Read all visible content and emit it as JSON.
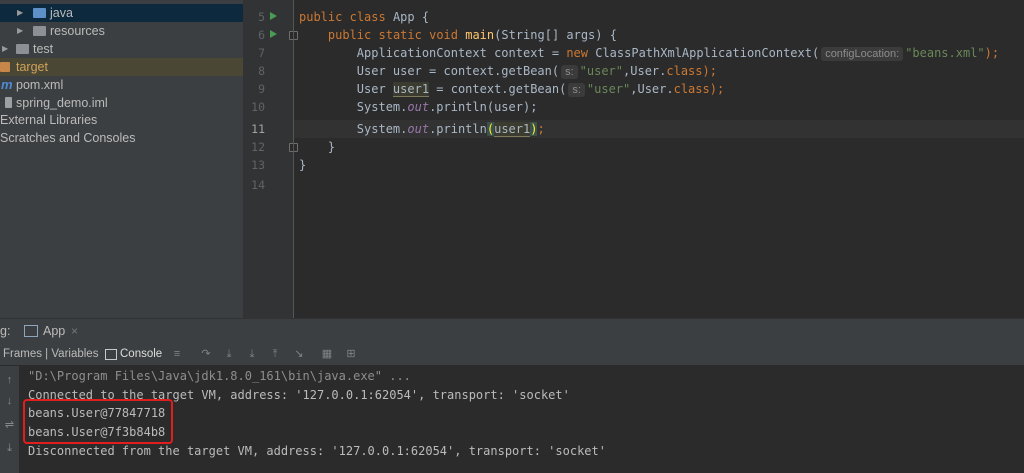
{
  "project_tree": {
    "items": [
      {
        "label": "java",
        "icon": "folder-source-icon"
      },
      {
        "label": "resources",
        "icon": "folder-resources-icon"
      },
      {
        "label": "test",
        "icon": "folder-icon"
      },
      {
        "label": "target",
        "icon": "folder-excluded-icon"
      },
      {
        "label": "pom.xml",
        "icon": "maven-icon"
      },
      {
        "label": "spring_demo.iml",
        "icon": "file-icon"
      },
      {
        "label": "External Libraries",
        "icon": "libraries-icon"
      },
      {
        "label": "Scratches and Consoles",
        "icon": "scratches-icon"
      }
    ]
  },
  "editor": {
    "line_numbers": [
      "5",
      "6",
      "7",
      "8",
      "9",
      "10",
      "11",
      "12",
      "13",
      "14"
    ],
    "current_line": "11",
    "code": {
      "l5": {
        "kw1": "public",
        "kw2": "class",
        "name": "App {"
      },
      "l6": {
        "kw1": "public",
        "kw2": "static",
        "kw3": "void",
        "fn": "main",
        "rest": "(String[] args) {"
      },
      "l7": {
        "a": "ApplicationContext context = ",
        "kw": "new",
        "b": " ClassPathXmlApplicationContext(",
        "hint": "configLocation:",
        "str": "\"beans.xml\"",
        "end": ");"
      },
      "l8": {
        "a": "User user = context.getBean(",
        "hint": "s:",
        "str": "\"user\"",
        "b": ",User.",
        "kw": "class",
        "end": ");"
      },
      "l9": {
        "a": "User ",
        "var": "user1",
        "b": " = context.getBean(",
        "hint": "s:",
        "str": "\"user\"",
        "c": ",User.",
        "kw": "class",
        "end": ");"
      },
      "l10": {
        "a": "System.",
        "out": "out",
        "b": ".println(user);"
      },
      "l11": {
        "a": "System.",
        "out": "out",
        "b": ".println",
        "lp": "(",
        "var": "user1",
        "rp": ")",
        "end": ";"
      },
      "l12": {
        "text": "}"
      },
      "l13": {
        "text": "}"
      }
    }
  },
  "run_window": {
    "label_prefix": "g:",
    "tab_label": "App",
    "tab_close": "×",
    "frames_label": "Frames | Variables",
    "console_tab": "Console",
    "toolbar_icons": [
      "menu-icon",
      "step-over-icon",
      "step-into-icon",
      "force-step-into-icon",
      "step-out-icon",
      "run-to-cursor-icon",
      "evaluate-icon",
      "threads-icon"
    ],
    "side_icons": [
      "up-arrow-icon",
      "down-arrow-icon",
      "soft-wrap-icon",
      "scroll-to-end-icon"
    ],
    "console_lines": [
      "\"D:\\Program Files\\Java\\jdk1.8.0_161\\bin\\java.exe\" ...",
      "Connected to the target VM, address: '127.0.0.1:62054', transport: 'socket'",
      "beans.User@77847718",
      "beans.User@7f3b84b8",
      "Disconnected from the target VM, address: '127.0.0.1:62054', transport: 'socket'"
    ]
  },
  "colors": {
    "keyword": "#cc7832",
    "method": "#ffc66d",
    "string": "#6a8759",
    "field": "#9876aa",
    "highlight_box": "#e01e1e"
  }
}
